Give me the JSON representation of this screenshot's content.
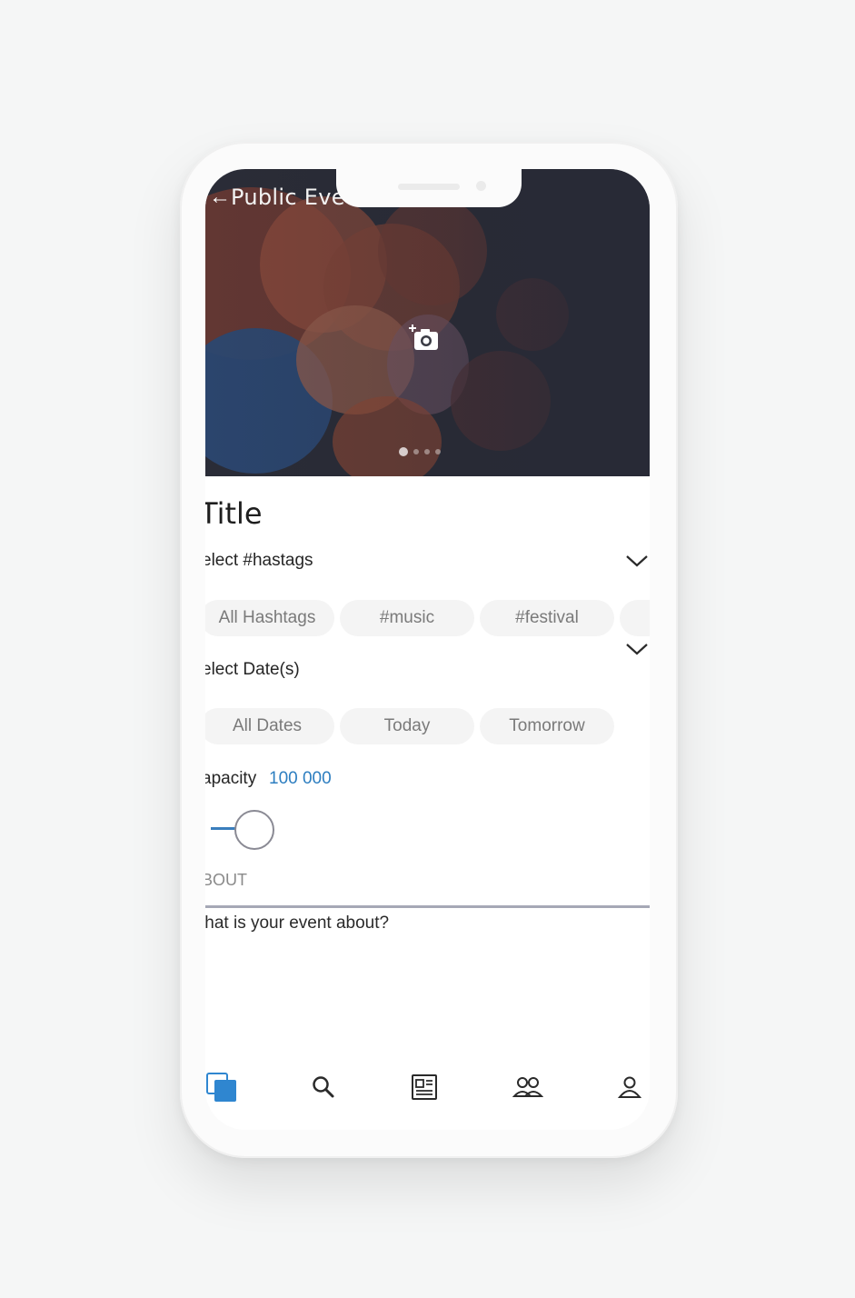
{
  "header": {
    "back_icon": "arrow-left-icon",
    "title": "Public Eve"
  },
  "hero": {
    "camera_icon": "add-photo-icon",
    "carousel": {
      "count": 4,
      "active_index": 0
    }
  },
  "form": {
    "title_placeholder": "Title",
    "hashtags": {
      "label": "elect #hastags",
      "chips": [
        "All Hashtags",
        "#music",
        "#festival"
      ]
    },
    "dates": {
      "label": "elect Date(s)",
      "chips": [
        "All Dates",
        "Today",
        "Tomorrow"
      ]
    },
    "capacity": {
      "label": "apacity",
      "value": "100 000",
      "value_color": "#2d7ec0",
      "slider_level": 0.0
    },
    "about": {
      "label": "BOUT",
      "placeholder": "/hat is your event about?"
    }
  },
  "tabbar": {
    "items": [
      {
        "icon": "events-icon",
        "active": true,
        "color": "#2f86d0"
      },
      {
        "icon": "search-icon",
        "active": false
      },
      {
        "icon": "news-icon",
        "active": false
      },
      {
        "icon": "people-icon",
        "active": false
      },
      {
        "icon": "profile-icon",
        "active": false
      }
    ]
  }
}
